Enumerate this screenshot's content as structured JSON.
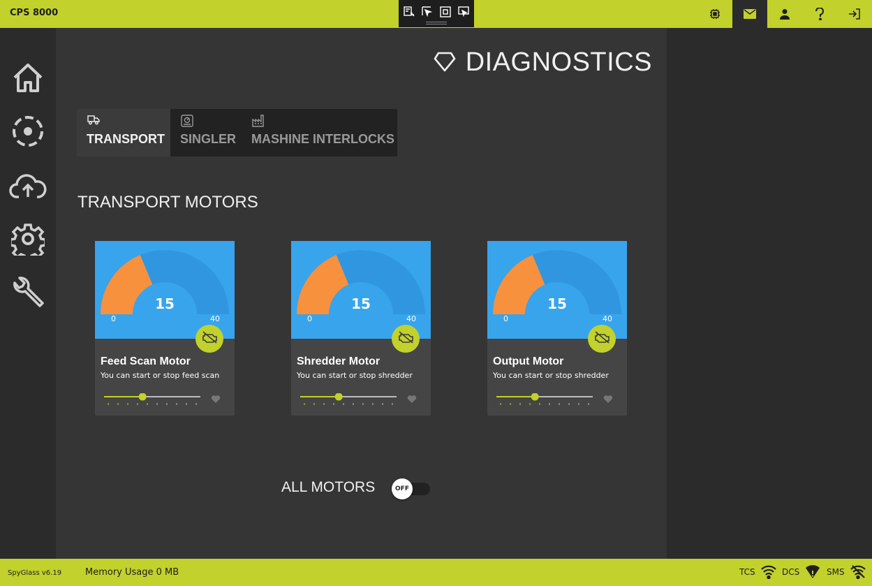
{
  "app": {
    "title": "CPS 8000"
  },
  "devtools": {
    "icons": [
      "select-element-icon",
      "inspect-cursor-icon",
      "layout-bounds-icon",
      "track-focus-icon"
    ]
  },
  "topnav": {
    "icons": [
      "chip-icon",
      "mail-icon",
      "user-icon",
      "help-icon",
      "logout-icon"
    ],
    "active": "mail-icon"
  },
  "sidebar": {
    "icons": [
      "home-icon",
      "dashed-circle-icon",
      "cloud-upload-icon",
      "gear-icon",
      "wrench-icon"
    ]
  },
  "page": {
    "title": "DIAGNOSTICS",
    "title_icon": "diamond-icon"
  },
  "tabs": [
    {
      "label": "TRANSPORT",
      "icon": "truck-icon",
      "active": true
    },
    {
      "label": "SINGLER",
      "icon": "singler-icon",
      "active": false
    },
    {
      "label": "MASHINE INTERLOCKS",
      "icon": "factory-icon",
      "active": false
    }
  ],
  "section": {
    "title": "TRANSPORT MOTORS"
  },
  "motors": [
    {
      "name": "Feed Scan Motor",
      "description": "You can start or stop feed scan",
      "value": "15",
      "min": "0",
      "max": "40",
      "slider_fraction": 0.4
    },
    {
      "name": "Shredder Motor",
      "description": "You can start or stop shredder",
      "value": "15",
      "min": "0",
      "max": "40",
      "slider_fraction": 0.4
    },
    {
      "name": "Output Motor",
      "description": "You can start or stop shredder",
      "value": "15",
      "min": "0",
      "max": "40",
      "slider_fraction": 0.4
    }
  ],
  "all_motors": {
    "label": "ALL MOTORS",
    "toggle_text": "OFF",
    "on": false
  },
  "status": {
    "version": "SpyGlass v6.19",
    "memory": "Memory Usage 0 MB",
    "connections": [
      {
        "label": "TCS"
      },
      {
        "label": "DCS"
      },
      {
        "label": "SMS"
      }
    ]
  },
  "colors": {
    "accent": "#c2d12b",
    "gauge_bg": "#38a4ec",
    "gauge_track": "#3196e0",
    "gauge_fill": "#f7913d",
    "panel": "#353535",
    "dark": "#2b2b2b"
  }
}
